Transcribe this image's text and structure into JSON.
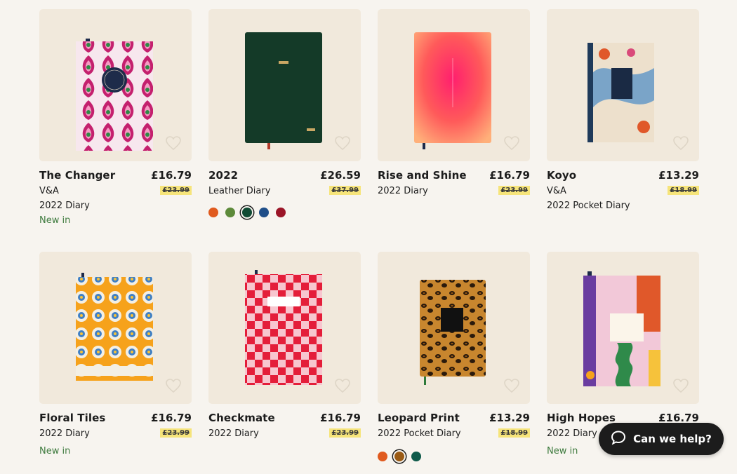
{
  "help_button": {
    "label": "Can we help?"
  },
  "products": [
    {
      "name": "The Changer",
      "price": "£16.79",
      "was": "£23.99",
      "line1": "V&A",
      "line2": "2022 Diary",
      "badge": "New in",
      "cover": "#c4206e"
    },
    {
      "name": "2022",
      "price": "£26.59",
      "was": "£37.99",
      "line1": "Leather Diary",
      "line2": "",
      "badge": "",
      "cover": "#143a28",
      "swatches": [
        "#e05a1e",
        "#5d8a3a",
        "#0f4a33",
        "#1f4e88",
        "#9b1527"
      ],
      "selected": 2
    },
    {
      "name": "Rise and Shine",
      "price": "£16.79",
      "was": "£23.99",
      "line1": "2022 Diary",
      "line2": "",
      "badge": "",
      "cover": "#ff3d7f"
    },
    {
      "name": "Koyo",
      "price": "£13.29",
      "was": "£18.99",
      "line1": "V&A",
      "line2": "2022 Pocket Diary",
      "badge": "",
      "cover": "#e9d7c0"
    },
    {
      "name": "Floral Tiles",
      "price": "£16.79",
      "was": "£23.99",
      "line1": "2022 Diary",
      "line2": "",
      "badge": "New in",
      "cover": "#f6a21b"
    },
    {
      "name": "Checkmate",
      "price": "£16.79",
      "was": "£23.99",
      "line1": "2022 Diary",
      "line2": "",
      "badge": "",
      "cover": "#e41e3a"
    },
    {
      "name": "Leopard Print",
      "price": "£13.29",
      "was": "£18.99",
      "line1": "2022 Pocket Diary",
      "line2": "",
      "badge": "",
      "cover": "#c8862e",
      "swatches": [
        "#e05a1e",
        "#9a5a14",
        "#0f5a4a"
      ],
      "selected": 1
    },
    {
      "name": "High Hopes",
      "price": "£16.79",
      "was": "",
      "line1": "2022 Diary",
      "line2": "",
      "badge": "New in",
      "cover": "#f2c8d8"
    }
  ]
}
